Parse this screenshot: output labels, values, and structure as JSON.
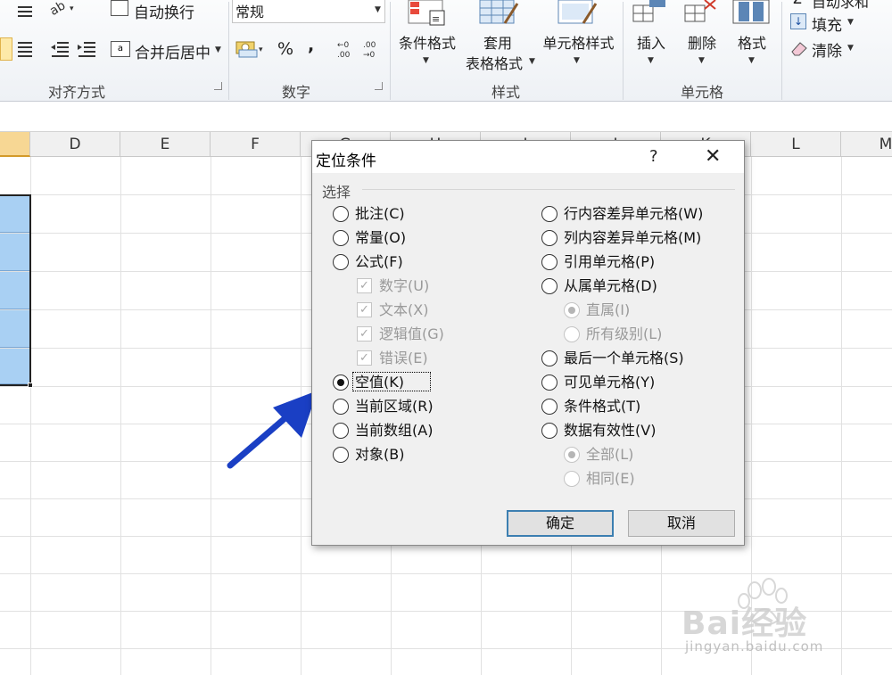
{
  "ribbon": {
    "alignment": {
      "wrap_text": "自动换行",
      "merge_center": "合并后居中",
      "group_label": "对齐方式"
    },
    "number": {
      "format_value": "常规",
      "percent": "%",
      "comma": ",",
      "increase_decimal": "+.0 .00",
      "decrease_decimal": ".00 →.0",
      "group_label": "数字"
    },
    "styles": {
      "conditional_format": "条件格式",
      "table_format_line1": "套用",
      "table_format_line2": "表格格式",
      "cell_styles": "单元格样式",
      "group_label": "样式"
    },
    "cells": {
      "insert": "插入",
      "delete": "删除",
      "format": "格式",
      "group_label": "单元格"
    },
    "editing": {
      "autosum": "自动求和",
      "fill": "填充",
      "clear": "清除"
    }
  },
  "columns": [
    "D",
    "E",
    "F",
    "G",
    "H",
    "I",
    "J",
    "K",
    "L",
    "M"
  ],
  "dialog": {
    "title": "定位条件",
    "help": "?",
    "close": "✕",
    "section": "选择",
    "left_options": [
      {
        "label": "批注(C)",
        "checked": false
      },
      {
        "label": "常量(O)",
        "checked": false
      },
      {
        "label": "公式(F)",
        "checked": false
      },
      {
        "label": "数字(U)",
        "checked": true
      },
      {
        "label": "文本(X)",
        "checked": true
      },
      {
        "label": "逻辑值(G)",
        "checked": true
      },
      {
        "label": "错误(E)",
        "checked": true
      },
      {
        "label": "空值(K)",
        "checked": true
      },
      {
        "label": "当前区域(R)",
        "checked": false
      },
      {
        "label": "当前数组(A)",
        "checked": false
      },
      {
        "label": "对象(B)",
        "checked": false
      }
    ],
    "right_options": [
      {
        "label": "行内容差异单元格(W)",
        "checked": false
      },
      {
        "label": "列内容差异单元格(M)",
        "checked": false
      },
      {
        "label": "引用单元格(P)",
        "checked": false
      },
      {
        "label": "从属单元格(D)",
        "checked": false
      },
      {
        "label": "直属(I)",
        "checked": true
      },
      {
        "label": "所有级别(L)",
        "checked": false
      },
      {
        "label": "最后一个单元格(S)",
        "checked": false
      },
      {
        "label": "可见单元格(Y)",
        "checked": false
      },
      {
        "label": "条件格式(T)",
        "checked": false
      },
      {
        "label": "数据有效性(V)",
        "checked": false
      },
      {
        "label": "全部(L)",
        "checked": true
      },
      {
        "label": "相同(E)",
        "checked": false
      }
    ],
    "ok": "确定",
    "cancel": "取消"
  },
  "watermark": {
    "brand": "Bai经验",
    "url": "jingyan.baidu.com"
  },
  "colors": {
    "selection": "#a9d0f3",
    "arrow": "#1a3fc4",
    "primary_border": "#3c7fb1"
  }
}
